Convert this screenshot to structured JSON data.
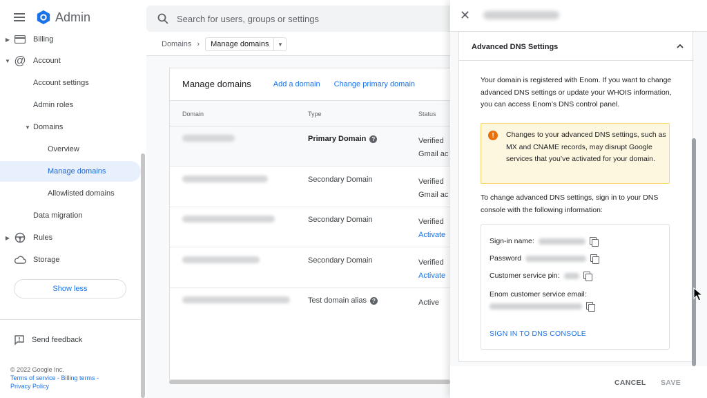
{
  "app": {
    "title": "Admin",
    "brand_color": "#1a73e8"
  },
  "search": {
    "placeholder": "Search for users, groups or settings"
  },
  "sidebar": {
    "items": [
      {
        "label": "Billing"
      },
      {
        "label": "Account"
      },
      {
        "label": "Account settings"
      },
      {
        "label": "Admin roles"
      },
      {
        "label": "Domains"
      },
      {
        "label": "Overview"
      },
      {
        "label": "Manage domains"
      },
      {
        "label": "Allowlisted domains"
      },
      {
        "label": "Data migration"
      },
      {
        "label": "Rules"
      },
      {
        "label": "Storage"
      }
    ],
    "show_less": "Show less",
    "feedback": "Send feedback",
    "footer": {
      "copyright": "© 2022 Google Inc.",
      "terms": "Terms of service",
      "sep": " - ",
      "billing_terms": "Billing terms",
      "sep2": " -",
      "privacy": "Privacy Policy"
    }
  },
  "breadcrumb": {
    "root": "Domains",
    "sep": "›",
    "current": "Manage domains"
  },
  "card": {
    "title": "Manage domains",
    "add_domain": "Add a domain",
    "change_primary": "Change primary domain",
    "columns": {
      "domain": "Domain",
      "type": "Type",
      "status": "Status"
    },
    "rows": [
      {
        "type": "Primary Domain",
        "status": "Verified",
        "status2": "Gmail ac",
        "help": true
      },
      {
        "type": "Secondary Domain",
        "status": "Verified",
        "status2": "Gmail ac",
        "help": false
      },
      {
        "type": "Secondary Domain",
        "status": "Verified",
        "status2": "Activate",
        "help": false
      },
      {
        "type": "Secondary Domain",
        "status": "Verified",
        "status2": "Activate",
        "help": false
      },
      {
        "type": "Test domain alias",
        "status": "Active",
        "status2": "",
        "help": true
      }
    ]
  },
  "panel": {
    "section_title": "Advanced DNS Settings",
    "intro": "Your domain is registered with Enom. If you want to change advanced DNS settings or update your WHOIS information, you can access Enom’s DNS control panel.",
    "warning": "Changes to your advanced DNS settings, such as MX and CNAME records, may disrupt Google services that you’ve activated for your domain.",
    "instructions": "To change advanced DNS settings, sign in to your DNS console with the following information:",
    "fields": {
      "signin_name": "Sign-in name:",
      "password": "Password",
      "pin": "Customer service pin:",
      "email": "Enom customer service email:"
    },
    "signin_button": "SIGN IN TO DNS CONSOLE",
    "cancel": "CANCEL",
    "save": "SAVE"
  }
}
